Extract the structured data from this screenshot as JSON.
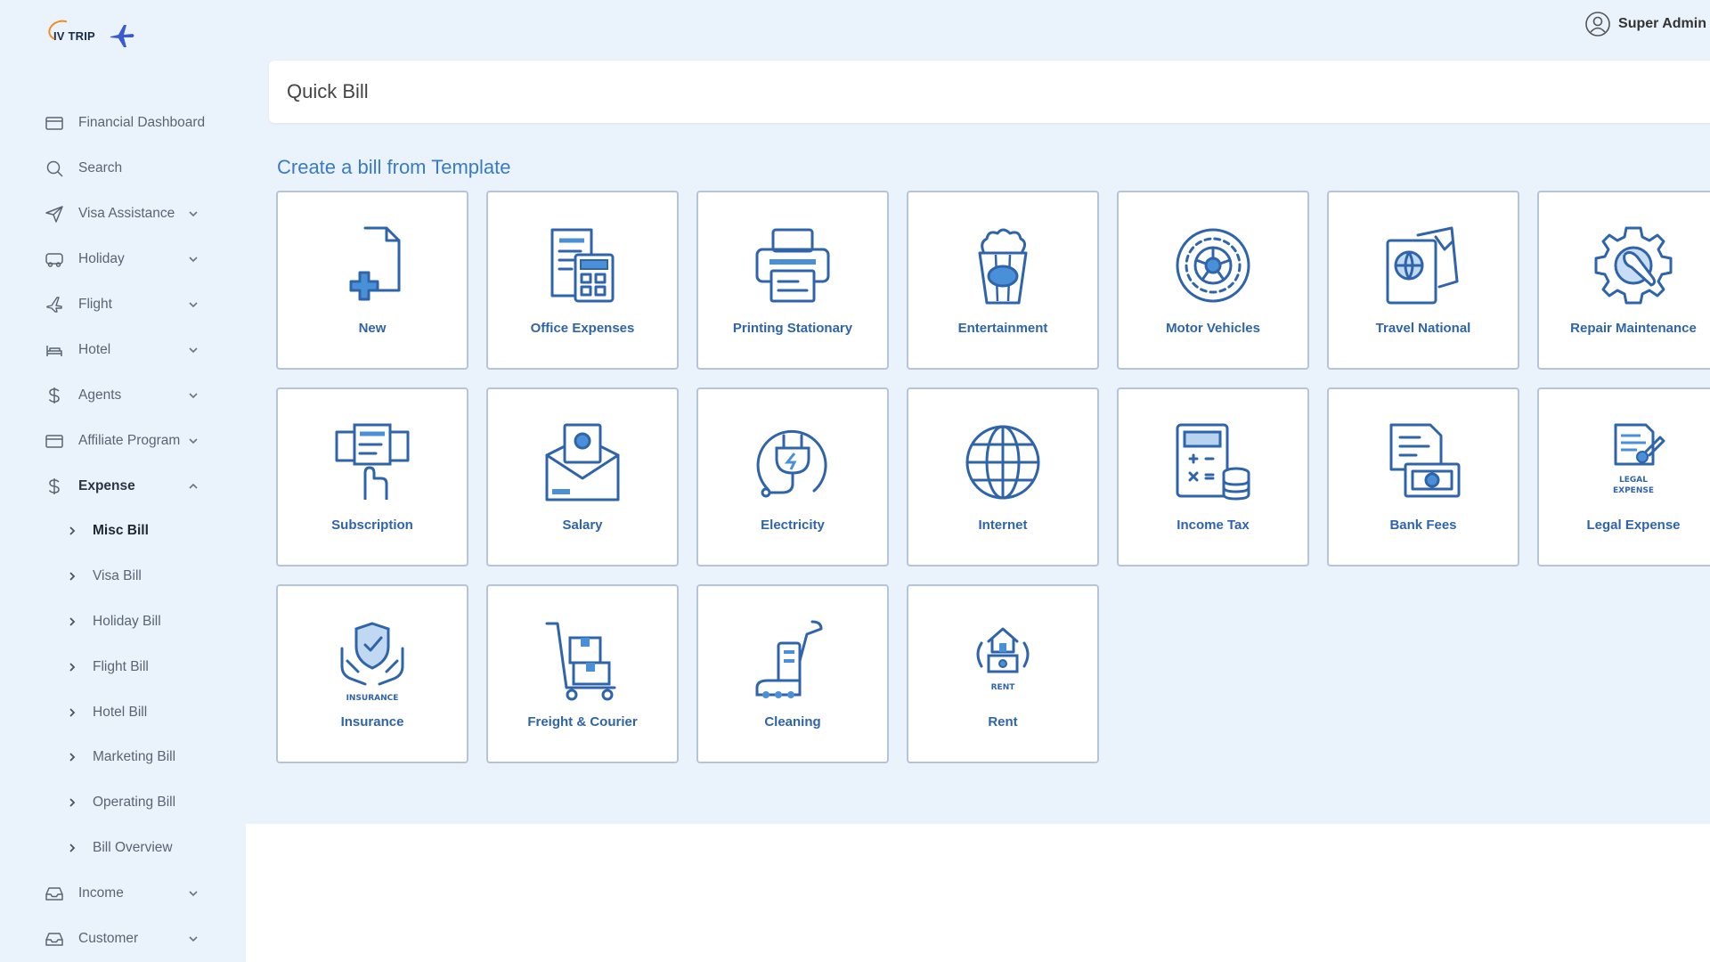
{
  "brand": {
    "logo_text": "IV TRIP"
  },
  "user": {
    "name": "Super Admin"
  },
  "page": {
    "title": "Quick Bill",
    "section": "Create a bill from Template"
  },
  "sidebar": {
    "items": [
      {
        "label": "Financial Dashboard",
        "icon": "card-icon",
        "chevron": false
      },
      {
        "label": "Search",
        "icon": "search-icon",
        "chevron": false
      },
      {
        "label": "Visa Assistance",
        "icon": "send-icon",
        "chevron": true
      },
      {
        "label": "Holiday",
        "icon": "bus-icon",
        "chevron": true
      },
      {
        "label": "Flight",
        "icon": "plane-icon",
        "chevron": true
      },
      {
        "label": "Hotel",
        "icon": "bed-icon",
        "chevron": true
      },
      {
        "label": "Agents",
        "icon": "dollar-icon",
        "chevron": true
      },
      {
        "label": "Affiliate Program",
        "icon": "card-icon",
        "chevron": true
      },
      {
        "label": "Expense",
        "icon": "dollar-icon",
        "chevron": true,
        "expanded": true
      }
    ],
    "subitems": [
      {
        "label": "Misc Bill",
        "active": true
      },
      {
        "label": "Visa Bill"
      },
      {
        "label": "Holiday Bill"
      },
      {
        "label": "Flight Bill"
      },
      {
        "label": "Hotel Bill"
      },
      {
        "label": "Marketing Bill"
      },
      {
        "label": "Operating Bill"
      },
      {
        "label": "Bill Overview"
      }
    ],
    "bottom_items": [
      {
        "label": "Income",
        "icon": "inbox-icon",
        "chevron": true
      },
      {
        "label": "Customer",
        "icon": "inbox-icon",
        "chevron": true
      }
    ]
  },
  "templates": [
    {
      "label": "New",
      "icon": "new-file-icon"
    },
    {
      "label": "Office Expenses",
      "icon": "office-expenses-icon"
    },
    {
      "label": "Printing Stationary",
      "icon": "printer-icon"
    },
    {
      "label": "Entertainment",
      "icon": "popcorn-icon"
    },
    {
      "label": "Motor Vehicles",
      "icon": "tire-icon"
    },
    {
      "label": "Travel National",
      "icon": "passport-icon"
    },
    {
      "label": "Repair Maintenance",
      "icon": "gear-wrench-icon"
    },
    {
      "label": "Subscription",
      "icon": "subscription-icon"
    },
    {
      "label": "Salary",
      "icon": "salary-envelope-icon"
    },
    {
      "label": "Electricity",
      "icon": "plug-icon"
    },
    {
      "label": "Internet",
      "icon": "globe-icon"
    },
    {
      "label": "Income Tax",
      "icon": "calculator-icon"
    },
    {
      "label": "Bank Fees",
      "icon": "bank-fees-icon"
    },
    {
      "label": "Legal Expense",
      "icon": "legal-expense-icon",
      "caption": "LEGAL EXPENSE"
    },
    {
      "label": "Insurance",
      "icon": "insurance-icon",
      "caption": "INSURANCE"
    },
    {
      "label": "Freight & Courier",
      "icon": "cart-icon"
    },
    {
      "label": "Cleaning",
      "icon": "vacuum-icon"
    },
    {
      "label": "Rent",
      "icon": "rent-icon",
      "caption": "RENT"
    }
  ],
  "colors": {
    "sidebar_bg": "#eaf3fb",
    "accent": "#2f64aa",
    "tile_border": "#b7c4d8",
    "heading": "#3b7ac4"
  }
}
